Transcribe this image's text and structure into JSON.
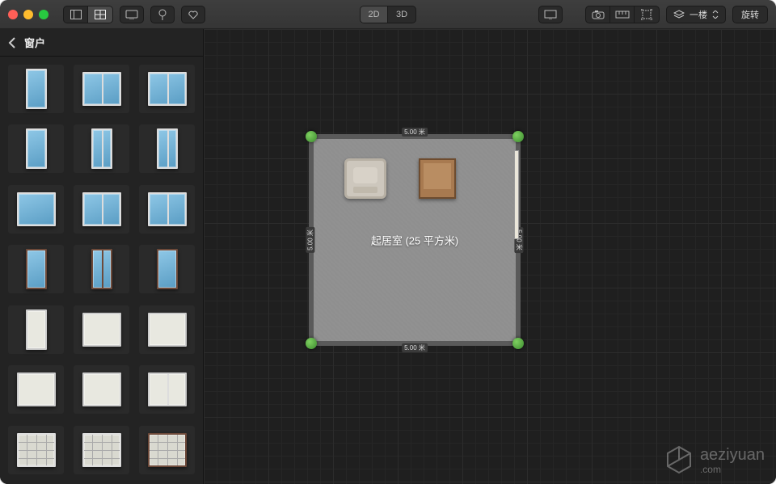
{
  "toolbar": {
    "view2d": "2D",
    "view3d": "3D",
    "floor_label": "一楼",
    "rotate": "旋转"
  },
  "sidebar": {
    "title": "窗户",
    "items": [
      {
        "name": "window-single-blue"
      },
      {
        "name": "window-double-blue"
      },
      {
        "name": "window-triple-blue"
      },
      {
        "name": "door-blue-tall-1"
      },
      {
        "name": "door-blue-tall-2"
      },
      {
        "name": "door-blue-tall-3"
      },
      {
        "name": "window-wide-blue-1"
      },
      {
        "name": "window-wide-blue-2"
      },
      {
        "name": "window-wide-blue-3"
      },
      {
        "name": "window-dark-tall-1"
      },
      {
        "name": "door-dark"
      },
      {
        "name": "window-dark-tall-2"
      },
      {
        "name": "window-white-tall"
      },
      {
        "name": "window-white-cross"
      },
      {
        "name": "window-white-panel"
      },
      {
        "name": "window-white-square"
      },
      {
        "name": "window-arched"
      },
      {
        "name": "window-white-triple"
      },
      {
        "name": "window-grid-1"
      },
      {
        "name": "window-grid-2"
      },
      {
        "name": "window-dark-grid"
      }
    ]
  },
  "room": {
    "label": "起居室 (25 平方米)",
    "dim_top": "5.00 米",
    "dim_bottom": "5.00 米",
    "dim_left": "5.00 米",
    "dim_right": "5.00 米"
  },
  "watermark": {
    "name": "aeziyuan",
    "suffix": ".com"
  }
}
